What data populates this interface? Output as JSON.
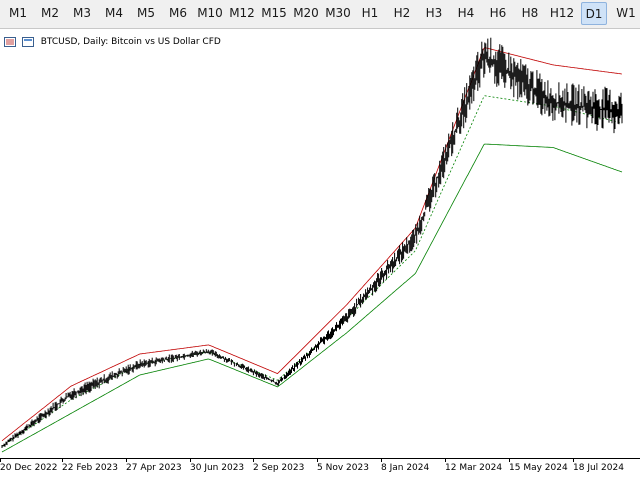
{
  "toolbar": {
    "timeframes": [
      "M1",
      "M2",
      "M3",
      "M4",
      "M5",
      "M6",
      "M10",
      "M12",
      "M15",
      "M20",
      "M30",
      "H1",
      "H2",
      "H3",
      "H4",
      "H6",
      "H8",
      "H12",
      "D1",
      "W1"
    ],
    "active": "D1"
  },
  "header": {
    "title": "BTCUSD, Daily:  Bitcoin vs US Dollar CFD"
  },
  "xaxis": {
    "labels": [
      "20 Dec 2022",
      "22 Feb 2023",
      "27 Apr 2023",
      "30 Jun 2023",
      "2 Sep 2023",
      "5 Nov 2023",
      "8 Jan 2024",
      "12 Mar 2024",
      "15 May 2024",
      "18 Jul 2024"
    ]
  },
  "colors": {
    "price": "#000000",
    "upper_band": "#c00000",
    "lower_band": "#008000",
    "middle_band": "#008000",
    "active_tab": "#cfe2f7"
  },
  "chart_data": {
    "type": "line",
    "indicator": "Bollinger Bands",
    "x": [
      "20 Dec 2022",
      "22 Feb 2023",
      "27 Apr 2023",
      "30 Jun 2023",
      "2 Sep 2023",
      "5 Nov 2023",
      "8 Jan 2024",
      "12 Mar 2024",
      "15 May 2024",
      "18 Jul 2024"
    ],
    "price": [
      16800,
      24200,
      28500,
      30400,
      25800,
      35100,
      46800,
      72500,
      66000,
      64500
    ],
    "upper_band": [
      17600,
      25400,
      30000,
      31300,
      27200,
      37000,
      48000,
      73800,
      71300,
      70000
    ],
    "lower_band": [
      16000,
      21500,
      27000,
      29300,
      25300,
      33000,
      41500,
      60000,
      59500,
      56000
    ],
    "grid": false
  }
}
